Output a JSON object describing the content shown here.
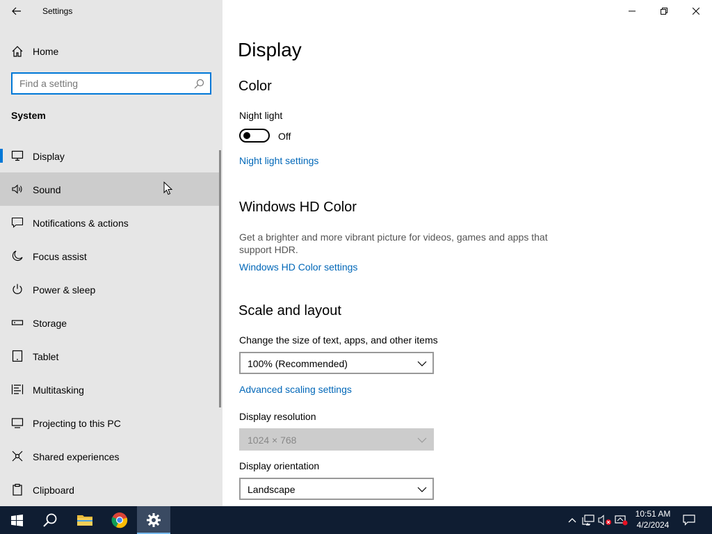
{
  "app": {
    "title": "Settings"
  },
  "sidebar": {
    "home_label": "Home",
    "search_placeholder": "Find a setting",
    "section_label": "System",
    "items": [
      {
        "label": "Display",
        "icon": "monitor-icon"
      },
      {
        "label": "Sound",
        "icon": "speaker-icon"
      },
      {
        "label": "Notifications & actions",
        "icon": "notification-icon"
      },
      {
        "label": "Focus assist",
        "icon": "moon-icon"
      },
      {
        "label": "Power & sleep",
        "icon": "power-icon"
      },
      {
        "label": "Storage",
        "icon": "storage-icon"
      },
      {
        "label": "Tablet",
        "icon": "tablet-icon"
      },
      {
        "label": "Multitasking",
        "icon": "multitasking-icon"
      },
      {
        "label": "Projecting to this PC",
        "icon": "projecting-icon"
      },
      {
        "label": "Shared experiences",
        "icon": "shared-icon"
      },
      {
        "label": "Clipboard",
        "icon": "clipboard-icon"
      }
    ],
    "active_index": 0,
    "hover_index": 1
  },
  "main": {
    "page_title": "Display",
    "color": {
      "heading": "Color",
      "night_light_label": "Night light",
      "night_light_state": "Off",
      "night_light_settings_link": "Night light settings"
    },
    "hd_color": {
      "heading": "Windows HD Color",
      "description": "Get a brighter and more vibrant picture for videos, games and apps that support HDR.",
      "settings_link": "Windows HD Color settings"
    },
    "scale_layout": {
      "heading": "Scale and layout",
      "size_label": "Change the size of text, apps, and other items",
      "size_value": "100% (Recommended)",
      "advanced_link": "Advanced scaling settings",
      "resolution_label": "Display resolution",
      "resolution_value": "1024 × 768",
      "orientation_label": "Display orientation",
      "orientation_value": "Landscape"
    }
  },
  "taskbar": {
    "time": "10:51 AM",
    "date": "4/2/2024"
  },
  "colors": {
    "accent": "#0078d7",
    "link": "#0067b8",
    "sidebar_bg": "#e6e6e6",
    "taskbar_bg": "#0f1d32"
  }
}
